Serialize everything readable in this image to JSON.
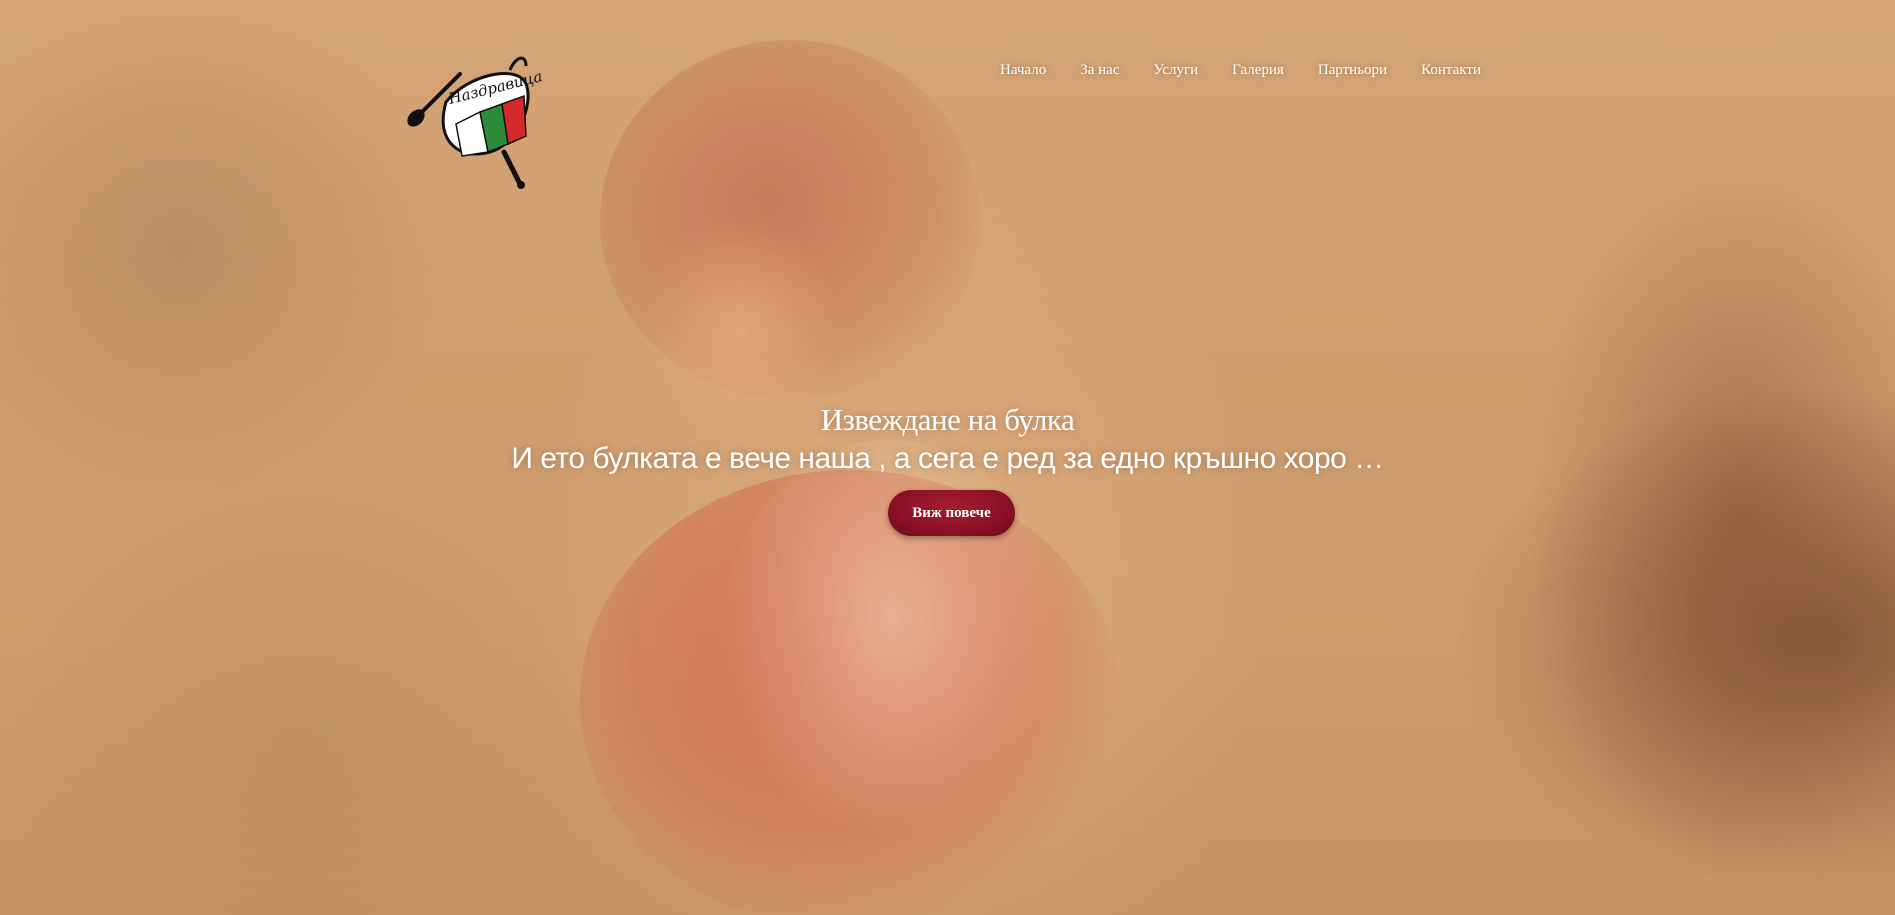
{
  "brand": {
    "logo_text": "Наздравица",
    "logo_icon": "flag-frying-pan-logo",
    "colors": {
      "flag_white": "#ffffff",
      "flag_green": "#2e8b3a",
      "flag_red": "#d42a2a"
    }
  },
  "nav": {
    "items": [
      {
        "label": "Начало"
      },
      {
        "label": "За нас"
      },
      {
        "label": "Услуги"
      },
      {
        "label": "Галерия"
      },
      {
        "label": "Партньори"
      },
      {
        "label": "Контакти"
      }
    ]
  },
  "hero": {
    "title": "Извеждане на булка",
    "subtitle": "И ето булката е вече наша , а сега е ред за едно кръшно хоро …",
    "cta_label": "Виж повече",
    "accent_color": "#8b1126"
  }
}
